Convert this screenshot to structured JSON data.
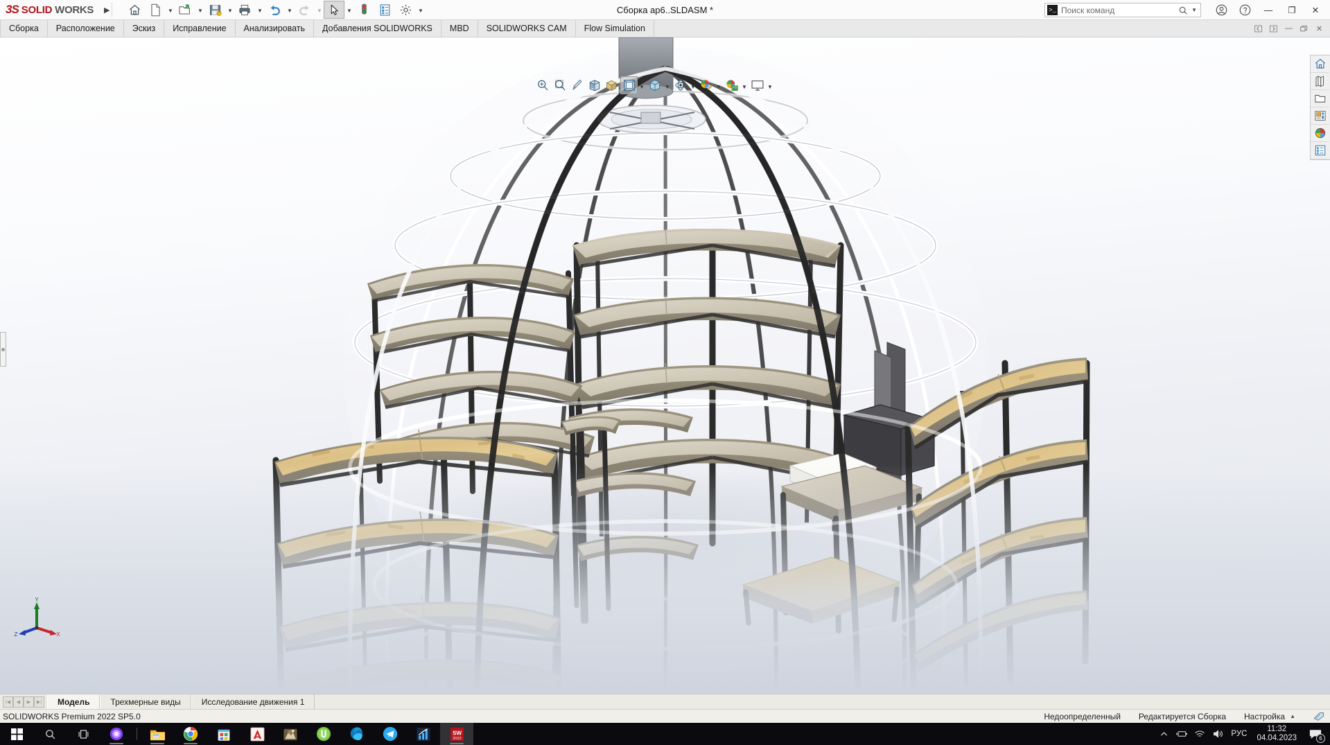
{
  "app": {
    "brand_ds": "3S",
    "brand_solid": "SOLID",
    "brand_works": "WORKS",
    "document_title": "Сборка ар6..SLDASM *",
    "version_text": "SOLIDWORKS Premium 2022 SP5.0",
    "accent_red": "#b3141e",
    "accent_gray": "#555555"
  },
  "quick_toolbar": {
    "items": [
      {
        "name": "home-icon",
        "label": "Домой",
        "caret": false,
        "active": false
      },
      {
        "name": "new-document-icon",
        "label": "Создать",
        "caret": true,
        "active": false
      },
      {
        "name": "open-document-icon",
        "label": "Открыть",
        "caret": true,
        "active": false
      },
      {
        "name": "save-icon",
        "label": "Сохранить",
        "caret": true,
        "active": false
      },
      {
        "name": "print-icon",
        "label": "Печать",
        "caret": true,
        "active": false
      },
      {
        "name": "undo-icon",
        "label": "Отменить",
        "caret": true,
        "active": false
      },
      {
        "name": "redo-icon",
        "label": "Повторить",
        "caret": true,
        "active": false
      },
      {
        "name": "select-cursor-icon",
        "label": "Выбрать",
        "caret": true,
        "active": true
      },
      {
        "name": "rebuild-icon",
        "label": "Перестроить",
        "caret": false,
        "active": false
      },
      {
        "name": "file-properties-icon",
        "label": "Свойства файла",
        "caret": false,
        "active": false
      },
      {
        "name": "options-gear-icon",
        "label": "Настройки",
        "caret": true,
        "active": false
      }
    ]
  },
  "search": {
    "placeholder": "Поиск команд",
    "value": "",
    "prompt_glyph": ">_"
  },
  "window_controls": {
    "account": "account-icon",
    "help": "help-icon",
    "minimize": "—",
    "restore": "❐",
    "close": "✕"
  },
  "doc_window_controls": {
    "prev": "◁",
    "next": "▷",
    "minimize": "—",
    "restore": "❐",
    "close": "✕"
  },
  "command_tabs": {
    "items": [
      {
        "label": "Сборка",
        "active": false
      },
      {
        "label": "Расположение",
        "active": false
      },
      {
        "label": "Эскиз",
        "active": false
      },
      {
        "label": "Исправление",
        "active": false
      },
      {
        "label": "Анализировать",
        "active": false
      },
      {
        "label": "Добавления SOLIDWORKS",
        "active": false
      },
      {
        "label": "MBD",
        "active": false
      },
      {
        "label": "SOLIDWORKS CAM",
        "active": false
      },
      {
        "label": "Flow Simulation",
        "active": false
      }
    ]
  },
  "view_toolbar": {
    "items": [
      {
        "name": "zoom-to-fit-icon",
        "label": "Увеличить элемент по размеру экрана",
        "caret": false,
        "active": false
      },
      {
        "name": "zoom-to-area-icon",
        "label": "Увеличить область",
        "caret": false,
        "active": false
      },
      {
        "name": "previous-view-icon",
        "label": "Предыдущий вид",
        "caret": false,
        "active": false
      },
      {
        "name": "section-view-icon",
        "label": "Разрез",
        "caret": false,
        "active": false
      },
      {
        "name": "view-orientation-icon",
        "label": "Ориентация вида",
        "caret": false,
        "active": false
      },
      {
        "name": "display-style-icon",
        "label": "Стиль отображения",
        "caret": false,
        "active": true
      },
      {
        "name": "hide-show-items-icon",
        "label": "Скрыть/показать элементы",
        "caret": true,
        "active": false
      },
      {
        "name": "edit-appearance-icon",
        "label": "Редактировать внешний вид",
        "caret": true,
        "active": false
      },
      {
        "name": "apply-scene-icon",
        "label": "Применить сцену",
        "caret": true,
        "active": false
      },
      {
        "name": "view-settings-icon",
        "label": "Настройки вида",
        "caret": true,
        "active": false
      },
      {
        "name": "viewport-icon",
        "label": "Окна просмотра",
        "caret": true,
        "active": false
      }
    ]
  },
  "task_pane": {
    "items": [
      {
        "name": "solidworks-resources-icon",
        "label": "Ресурсы SOLIDWORKS"
      },
      {
        "name": "design-library-icon",
        "label": "Библиотека проектирования"
      },
      {
        "name": "file-explorer-icon",
        "label": "Проводник"
      },
      {
        "name": "view-palette-icon",
        "label": "Палитра видов"
      },
      {
        "name": "appearances-scenes-icon",
        "label": "Внешние виды, сцены и felt"
      },
      {
        "name": "custom-properties-icon",
        "label": "Настройки"
      }
    ]
  },
  "document_tabs": {
    "nav_buttons": [
      "|◀",
      "◀",
      "▶",
      "▶|"
    ],
    "items": [
      {
        "label": "Модель",
        "active": true
      },
      {
        "label": "Трехмерные виды",
        "active": false
      },
      {
        "label": "Исследование движения 1",
        "active": false
      }
    ]
  },
  "status_bar": {
    "version": "SOLIDWORKS Premium 2022 SP5.0",
    "state": "Недоопределенный",
    "editing": "Редактируется Сборка",
    "config": "Настройка",
    "caret": "▲",
    "units_icon": "units-icon"
  },
  "triad": {
    "x_label": "X",
    "y_label": "Y",
    "z_label": "Z",
    "x_color": "#c3272b",
    "y_color": "#1b7a26",
    "z_color": "#1f3fb5"
  },
  "viewport": {
    "model_description": "Сферический геокупол с изогнутыми стеллажами из OSB-плит на чёрных металлических каркасах",
    "background_top": "#ffffff",
    "background_bottom": "#d6dbe4",
    "frame_color": "#2b2b2b",
    "shelf_color": "#e2c98f",
    "shelf_edge_color": "#9b9380"
  },
  "taskbar": {
    "items": [
      {
        "name": "start-button",
        "label": "Пуск",
        "glyph": "windows"
      },
      {
        "name": "search-taskbar-button",
        "label": "Поиск",
        "glyph": "search"
      },
      {
        "name": "task-view-button",
        "label": "Представление задач",
        "glyph": "taskview"
      },
      {
        "name": "cortana-app",
        "label": "Cortana",
        "glyph": "cortana",
        "running": false
      },
      {
        "name": "file-explorer-app",
        "label": "Проводник",
        "glyph": "explorer",
        "running": true
      },
      {
        "name": "chrome-app",
        "label": "Google Chrome",
        "glyph": "chrome",
        "running": true
      },
      {
        "name": "microsoft-store-app",
        "label": "Microsoft Store",
        "glyph": "store",
        "running": false
      },
      {
        "name": "autocad-app",
        "label": "AutoCAD",
        "glyph": "autocad",
        "running": false
      },
      {
        "name": "archicad-app",
        "label": "ArchiCAD",
        "glyph": "archicad",
        "running": false
      },
      {
        "name": "utorrent-app",
        "label": "uTorrent",
        "glyph": "utorrent",
        "running": false
      },
      {
        "name": "edge-app",
        "label": "Microsoft Edge",
        "glyph": "edge",
        "running": false
      },
      {
        "name": "telegram-app",
        "label": "Telegram",
        "glyph": "telegram",
        "running": false
      },
      {
        "name": "stats-app",
        "label": "Статистика",
        "glyph": "stats",
        "running": false
      },
      {
        "name": "solidworks-app",
        "label": "SOLIDWORKS 2022",
        "glyph": "sw2022",
        "running": true,
        "active": true
      }
    ],
    "tray": {
      "chevron": "^",
      "icons": [
        "battery-icon",
        "wifi-icon",
        "volume-icon"
      ],
      "language": "РУС",
      "time": "11:32",
      "date": "04.04.2023",
      "notification_count": "6"
    }
  }
}
